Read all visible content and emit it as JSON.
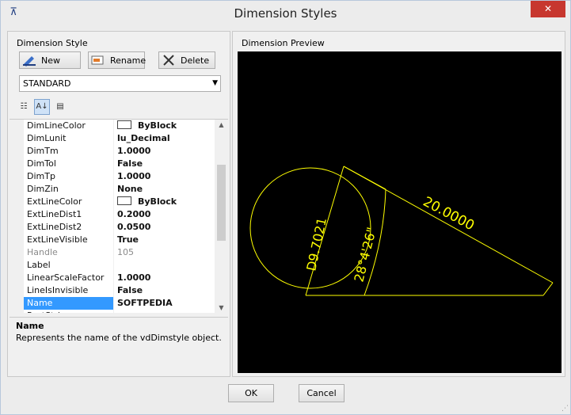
{
  "window": {
    "title": "Dimension Styles",
    "close_label": "✕"
  },
  "left": {
    "group_label": "Dimension Style",
    "buttons": {
      "new": "New",
      "rename": "Rename",
      "delete": "Delete"
    },
    "style_select": "STANDARD",
    "properties": [
      {
        "name": "DimLineColor",
        "value": "ByBlock",
        "swatch": true
      },
      {
        "name": "DimLunit",
        "value": "lu_Decimal"
      },
      {
        "name": "DimTm",
        "value": "1.0000"
      },
      {
        "name": "DimTol",
        "value": "False"
      },
      {
        "name": "DimTp",
        "value": "1.0000"
      },
      {
        "name": "DimZin",
        "value": "None"
      },
      {
        "name": "ExtLineColor",
        "value": "ByBlock",
        "swatch": true
      },
      {
        "name": "ExtLineDist1",
        "value": "0.2000"
      },
      {
        "name": "ExtLineDist2",
        "value": "0.0500"
      },
      {
        "name": "ExtLineVisible",
        "value": "True"
      },
      {
        "name": "Handle",
        "value": "105",
        "disabled": true
      },
      {
        "name": "Label",
        "value": ""
      },
      {
        "name": "LinearScaleFactor",
        "value": "1.0000"
      },
      {
        "name": "LineIsInvisible",
        "value": "False"
      },
      {
        "name": "Name",
        "value": "SOFTPEDIA",
        "selected": true
      },
      {
        "name": "PostString",
        "value": ""
      }
    ],
    "description": {
      "title": "Name",
      "text": "Represents the name of the vdDimstyle object."
    }
  },
  "preview": {
    "label": "Dimension Preview",
    "texts": {
      "diameter": "D9.7021",
      "angle": "28°4'26\"",
      "length": "20.0000"
    },
    "colors": {
      "background": "#000000",
      "geometry": "#ffff00"
    }
  },
  "dialog": {
    "ok": "OK",
    "cancel": "Cancel"
  }
}
